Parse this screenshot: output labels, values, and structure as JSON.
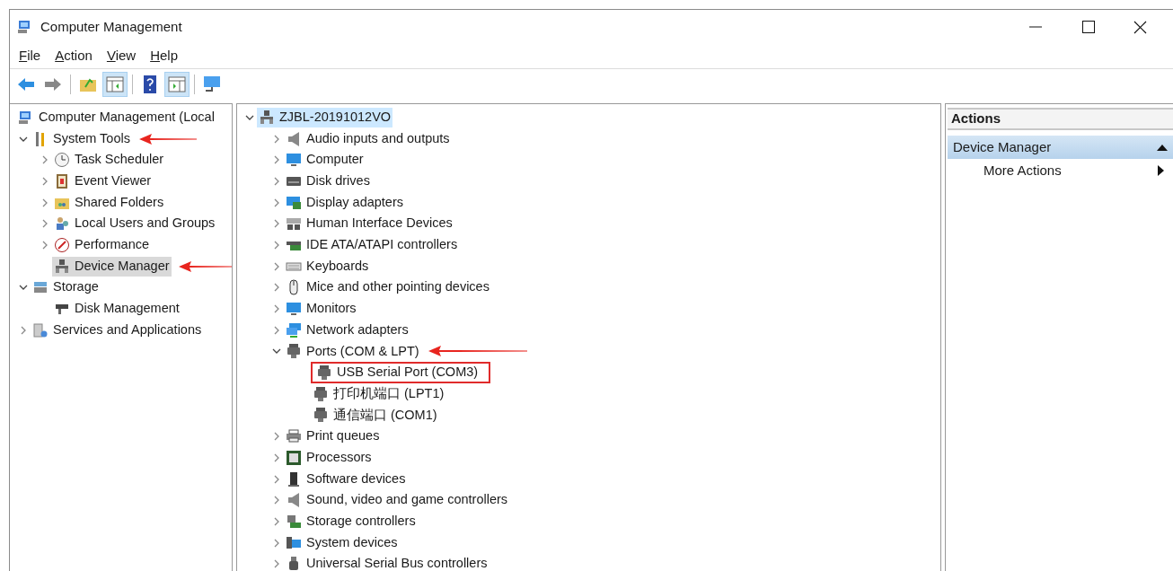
{
  "window": {
    "title": "Computer Management"
  },
  "menu": [
    "File",
    "Action",
    "View",
    "Help"
  ],
  "toolbar": [
    {
      "kind": "back",
      "pressed": false
    },
    {
      "kind": "forward",
      "pressed": false
    },
    {
      "kind": "sep"
    },
    {
      "kind": "up",
      "pressed": false
    },
    {
      "kind": "tree",
      "pressed": true
    },
    {
      "kind": "sep"
    },
    {
      "kind": "help",
      "pressed": false
    },
    {
      "kind": "actionpane",
      "pressed": true
    },
    {
      "kind": "sep"
    },
    {
      "kind": "connect",
      "pressed": false
    }
  ],
  "navigation_tree": [
    {
      "label": "Computer Management (Local",
      "expandable": false,
      "selected": false,
      "arrow": false,
      "children": [
        {
          "label": "System Tools",
          "expandable": true,
          "expanded": true,
          "selected": false,
          "arrow": true,
          "children": [
            {
              "label": "Task Scheduler",
              "expandable": true,
              "expanded": false,
              "selected": false,
              "arrow": false
            },
            {
              "label": "Event Viewer",
              "expandable": true,
              "expanded": false,
              "selected": false,
              "arrow": false
            },
            {
              "label": "Shared Folders",
              "expandable": true,
              "expanded": false,
              "selected": false,
              "arrow": false
            },
            {
              "label": "Local Users and Groups",
              "expandable": true,
              "expanded": false,
              "selected": false,
              "arrow": false
            },
            {
              "label": "Performance",
              "expandable": true,
              "expanded": false,
              "selected": false,
              "arrow": false
            },
            {
              "label": "Device Manager",
              "expandable": false,
              "selected": true,
              "arrow": true
            }
          ]
        },
        {
          "label": "Storage",
          "expandable": true,
          "expanded": true,
          "selected": false,
          "arrow": false,
          "children": [
            {
              "label": "Disk Management",
              "expandable": false,
              "selected": false,
              "arrow": false
            }
          ]
        },
        {
          "label": "Services and Applications",
          "expandable": true,
          "expanded": false,
          "selected": false,
          "arrow": false
        }
      ]
    }
  ],
  "device_tree": [
    {
      "label": "ZJBL-20191012VO",
      "expandable": true,
      "expanded": true,
      "selected": true,
      "arrow": false,
      "boxed": false,
      "children": [
        {
          "label": "Audio inputs and outputs",
          "expandable": true,
          "expanded": false,
          "selected": false,
          "arrow": false,
          "boxed": false
        },
        {
          "label": "Computer",
          "expandable": true,
          "expanded": false,
          "selected": false,
          "arrow": false,
          "boxed": false
        },
        {
          "label": "Disk drives",
          "expandable": true,
          "expanded": false,
          "selected": false,
          "arrow": false,
          "boxed": false
        },
        {
          "label": "Display adapters",
          "expandable": true,
          "expanded": false,
          "selected": false,
          "arrow": false,
          "boxed": false
        },
        {
          "label": "Human Interface Devices",
          "expandable": true,
          "expanded": false,
          "selected": false,
          "arrow": false,
          "boxed": false
        },
        {
          "label": "IDE ATA/ATAPI controllers",
          "expandable": true,
          "expanded": false,
          "selected": false,
          "arrow": false,
          "boxed": false
        },
        {
          "label": "Keyboards",
          "expandable": true,
          "expanded": false,
          "selected": false,
          "arrow": false,
          "boxed": false
        },
        {
          "label": "Mice and other pointing devices",
          "expandable": true,
          "expanded": false,
          "selected": false,
          "arrow": false,
          "boxed": false
        },
        {
          "label": "Monitors",
          "expandable": true,
          "expanded": false,
          "selected": false,
          "arrow": false,
          "boxed": false
        },
        {
          "label": "Network adapters",
          "expandable": true,
          "expanded": false,
          "selected": false,
          "arrow": false,
          "boxed": false
        },
        {
          "label": "Ports (COM & LPT)",
          "expandable": true,
          "expanded": true,
          "selected": false,
          "arrow": true,
          "boxed": false,
          "children": [
            {
              "label": "USB Serial Port (COM3)",
              "expandable": false,
              "selected": false,
              "arrow": false,
              "boxed": true
            },
            {
              "label": "打印机端口 (LPT1)",
              "expandable": false,
              "selected": false,
              "arrow": false,
              "boxed": false
            },
            {
              "label": "通信端口 (COM1)",
              "expandable": false,
              "selected": false,
              "arrow": false,
              "boxed": false
            }
          ]
        },
        {
          "label": "Print queues",
          "expandable": true,
          "expanded": false,
          "selected": false,
          "arrow": false,
          "boxed": false
        },
        {
          "label": "Processors",
          "expandable": true,
          "expanded": false,
          "selected": false,
          "arrow": false,
          "boxed": false
        },
        {
          "label": "Software devices",
          "expandable": true,
          "expanded": false,
          "selected": false,
          "arrow": false,
          "boxed": false
        },
        {
          "label": "Sound, video and game controllers",
          "expandable": true,
          "expanded": false,
          "selected": false,
          "arrow": false,
          "boxed": false
        },
        {
          "label": "Storage controllers",
          "expandable": true,
          "expanded": false,
          "selected": false,
          "arrow": false,
          "boxed": false
        },
        {
          "label": "System devices",
          "expandable": true,
          "expanded": false,
          "selected": false,
          "arrow": false,
          "boxed": false
        },
        {
          "label": "Universal Serial Bus controllers",
          "expandable": true,
          "expanded": false,
          "selected": false,
          "arrow": false,
          "boxed": false
        }
      ]
    }
  ],
  "actions": {
    "title": "Actions",
    "sections": [
      {
        "label": "Device Manager",
        "expanded": true,
        "items": [
          {
            "label": "More Actions"
          }
        ]
      }
    ]
  }
}
